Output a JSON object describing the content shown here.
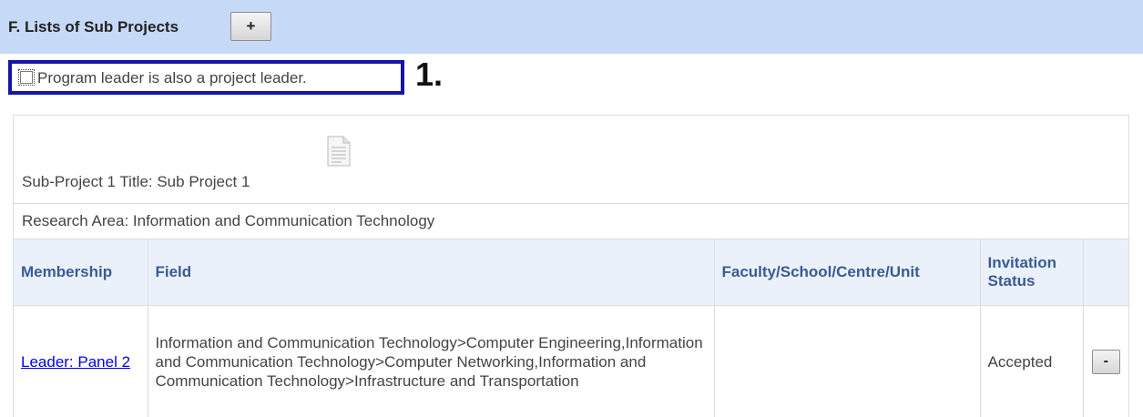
{
  "section": {
    "title": "F. Lists of Sub Projects",
    "add_label": "+"
  },
  "checkbox": {
    "label": "Program leader is also a project leader.",
    "checked": false
  },
  "annotation": "1.",
  "subproject": {
    "title_text": "Sub-Project 1 Title: Sub Project 1",
    "research_area": "Research Area: Information and Communication Technology",
    "icon": "document-icon"
  },
  "table": {
    "headers": [
      "Membership",
      "Field",
      "Faculty/School/Centre/Unit",
      "Invitation Status",
      ""
    ],
    "rows": [
      {
        "membership": "Leader: Panel 2",
        "field": "Information and Communication Technology>Computer Engineering,Information and Communication Technology>Computer Networking,Information and Communication Technology>Infrastructure and Transportation",
        "faculty": "",
        "status": "Accepted",
        "remove_label": "-"
      }
    ]
  }
}
